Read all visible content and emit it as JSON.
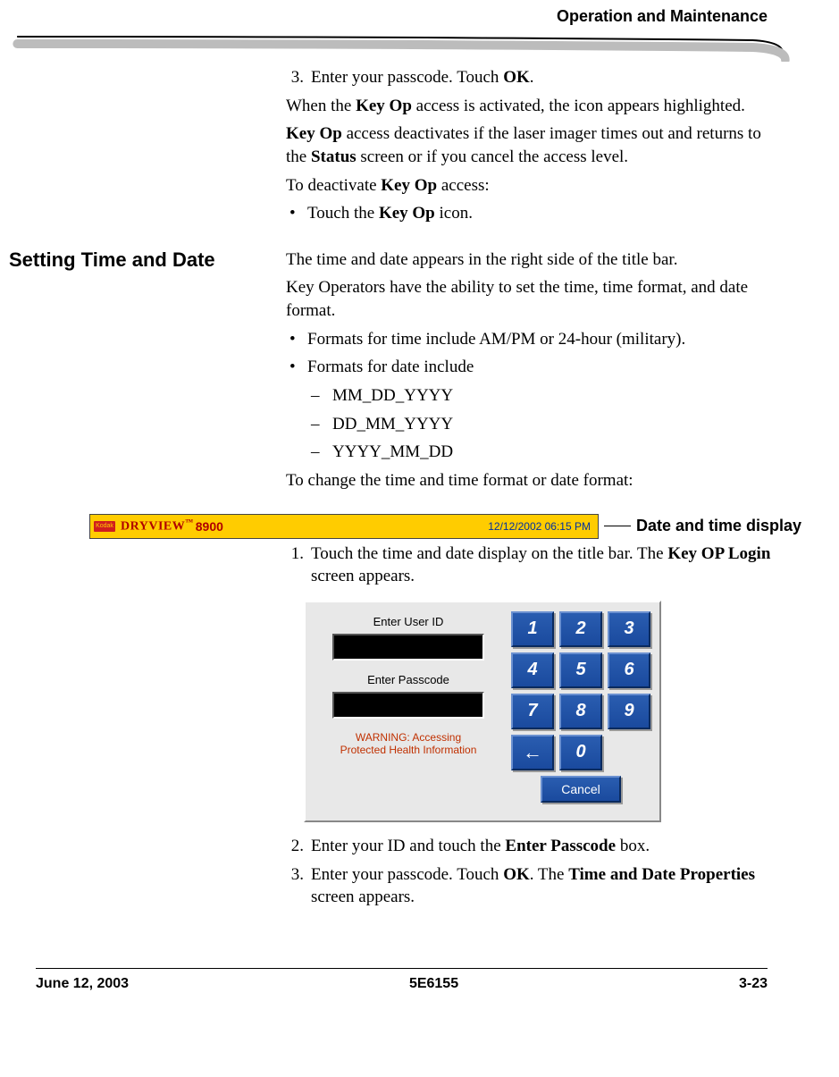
{
  "header": {
    "running_title": "Operation and Maintenance"
  },
  "intro": {
    "step3": "Enter your passcode. Touch ",
    "step3_bold": "OK",
    "step3_end": ".",
    "p1_a": "When the ",
    "p1_b": "Key Op",
    "p1_c": " access is activated, the icon appears highlighted.",
    "p2_a": "Key Op",
    "p2_b": " access deactivates if the laser imager times out and returns to the ",
    "p2_c": "Status",
    "p2_d": " screen or if you cancel the access level.",
    "p3_a": "To deactivate ",
    "p3_b": "Key Op",
    "p3_c": " access:",
    "bullet_a": "Touch the ",
    "bullet_b": "Key Op",
    "bullet_c": " icon."
  },
  "section": {
    "heading": "Setting Time and Date",
    "p1": "The time and date appears in the right side of the title bar.",
    "p2": "Key Operators have the ability to set the time, time format, and date format.",
    "b1": "Formats for time include AM/PM or 24-hour (military).",
    "b2": "Formats for date include",
    "d1": "MM_DD_YYYY",
    "d2": "DD_MM_YYYY",
    "d3": "YYYY_MM_DD",
    "p3": "To change the time and time format or date format:"
  },
  "titlebar": {
    "brand": "DRYVIEW",
    "model": "8900",
    "tm": "™",
    "datetime": "12/12/2002 06:15 PM",
    "callout": "Date and time display"
  },
  "steps": {
    "s1_a": "Touch the time and date display on the title bar. The ",
    "s1_b": "Key OP Login",
    "s1_c": " screen appears.",
    "s2_a": "Enter your ID and touch the ",
    "s2_b": "Enter Passcode",
    "s2_c": " box.",
    "s3_a": "Enter your passcode. Touch ",
    "s3_b": "OK",
    "s3_c": ". The ",
    "s3_d": "Time and Date Properties",
    "s3_e": " screen appears."
  },
  "login": {
    "label_userid": "Enter User ID",
    "label_passcode": "Enter Passcode",
    "warning_l1": "WARNING: Accessing",
    "warning_l2": "Protected Health Information",
    "keys": [
      "1",
      "2",
      "3",
      "4",
      "5",
      "6",
      "7",
      "8",
      "9",
      "←",
      "0"
    ],
    "cancel": "Cancel"
  },
  "footer": {
    "date": "June 12, 2003",
    "docnum": "5E6155",
    "page": "3-23"
  }
}
